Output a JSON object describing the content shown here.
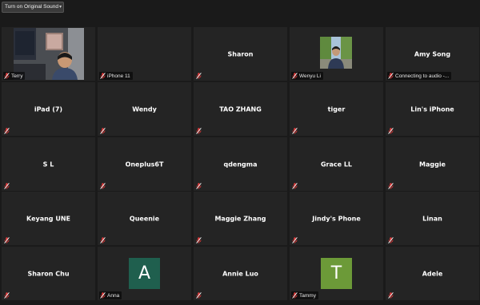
{
  "toolbar": {
    "sound_button_label": "Turn on Original Sound",
    "sound_button_caret": "▾"
  },
  "colors": {
    "muted_mic": "#e03a3a",
    "tile_bg": "#242424",
    "avatar_anna": "#1f5f4e",
    "avatar_tammy": "#6c9a38"
  },
  "participants": [
    {
      "name": "Terry",
      "footer": "Terry",
      "type": "video"
    },
    {
      "name": "iPhone 11",
      "footer": "iPhone 11",
      "type": "blank"
    },
    {
      "name": "Sharon",
      "footer": "",
      "type": "name"
    },
    {
      "name": "Wenyu Li",
      "footer": "Wenyu Li",
      "type": "photo"
    },
    {
      "name": "Amy Song",
      "footer": "Connecting to audio -...",
      "type": "name"
    },
    {
      "name": "iPad (7)",
      "footer": "",
      "type": "name"
    },
    {
      "name": "Wendy",
      "footer": "",
      "type": "name"
    },
    {
      "name": "TAO ZHANG",
      "footer": "",
      "type": "name"
    },
    {
      "name": "tiger",
      "footer": "",
      "type": "name"
    },
    {
      "name": "Lin's iPhone",
      "footer": "",
      "type": "name"
    },
    {
      "name": "S L",
      "footer": "",
      "type": "name"
    },
    {
      "name": "Oneplus6T",
      "footer": "",
      "type": "name"
    },
    {
      "name": "qdengma",
      "footer": "",
      "type": "name"
    },
    {
      "name": "Grace LL",
      "footer": "",
      "type": "name"
    },
    {
      "name": "Maggie",
      "footer": "",
      "type": "name"
    },
    {
      "name": "Keyang UNE",
      "footer": "",
      "type": "name"
    },
    {
      "name": "Queenie",
      "footer": "",
      "type": "name"
    },
    {
      "name": "Maggie Zhang",
      "footer": "",
      "type": "name"
    },
    {
      "name": "Jindy's Phone",
      "footer": "",
      "type": "name"
    },
    {
      "name": "Linan",
      "footer": "",
      "type": "name"
    },
    {
      "name": "Sharon Chu",
      "footer": "",
      "type": "name"
    },
    {
      "name": "Anna",
      "footer": "Anna",
      "type": "avatar",
      "letter": "A"
    },
    {
      "name": "Annie Luo",
      "footer": "",
      "type": "name"
    },
    {
      "name": "Tammy",
      "footer": "Tammy",
      "type": "avatar",
      "letter": "T"
    },
    {
      "name": "Adele",
      "footer": "",
      "type": "name"
    }
  ]
}
